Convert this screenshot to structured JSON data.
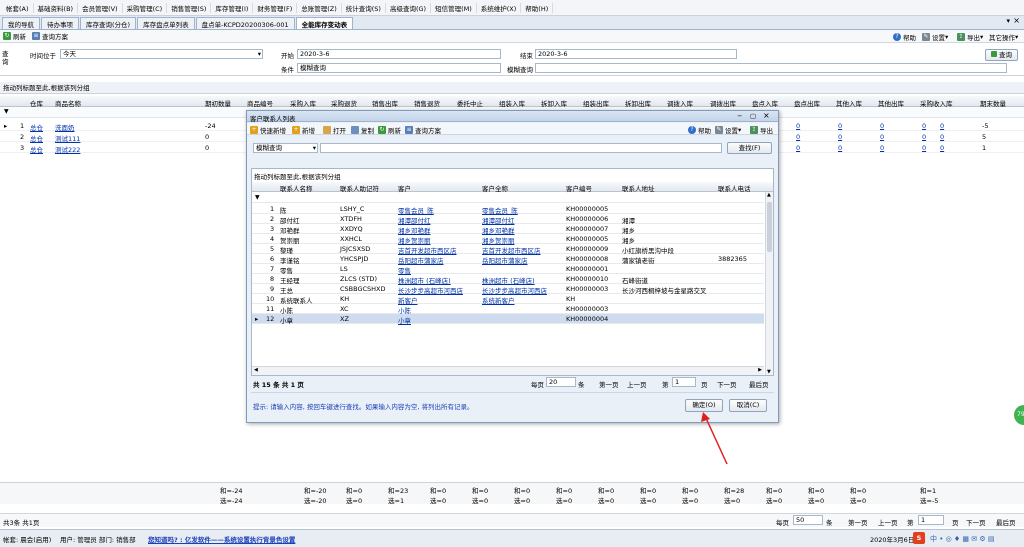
{
  "menu": [
    "帐套(A)",
    "基础资料(B)",
    "会员管理(V)",
    "采购管理(C)",
    "销售管理(S)",
    "库存管理(I)",
    "财务管理(F)",
    "总账管理(Z)",
    "统计查询(S)",
    "高级查询(G)",
    "短信管理(M)",
    "系统维护(X)",
    "帮助(H)"
  ],
  "tabs": [
    "我的导航",
    "待办事项",
    "库存查询(分仓)",
    "库存盘点单列表",
    "盘点单-KCPD20200306-001",
    "全能库存变动表"
  ],
  "toolbar": {
    "refresh": "刷新",
    "query_plan": "查询方案",
    "help": "帮助",
    "settings": "设置",
    "export": "导出",
    "other_ops": "其它操作"
  },
  "query": {
    "side_label": "查询",
    "time_label": "时间位于",
    "time_value": "今天",
    "start_label": "开始",
    "start_value": "2020-3-6",
    "end_label": "结束",
    "end_value": "2020-3-6",
    "cond_label": "条件",
    "cond_value": "模糊查询",
    "fuzzy_label": "模糊查询",
    "query_button": "查询"
  },
  "group_hint": "拖动列标题至此,根据该列分组",
  "main_table": {
    "headers": [
      "仓库",
      "商品名称",
      "期初数量",
      "商品编号",
      "采购入库",
      "采购退货",
      "销售出库",
      "销售退货",
      "委托中止",
      "组装入库",
      "拆卸入库",
      "组装出库",
      "拆卸出库",
      "调拨入库",
      "调拨出库",
      "盘点入库",
      "盘点出库",
      "其他入库",
      "其他出库",
      "采购收入库",
      "期末数量"
    ],
    "rows": [
      {
        "no": "1",
        "warehouse": "总仓",
        "product": "洗面奶",
        "opening": "-24",
        "c1": "0",
        "c2": "0",
        "c3": "0",
        "c4": "0",
        "c5": "0",
        "ending": "-5"
      },
      {
        "no": "2",
        "warehouse": "总仓",
        "product": "测试111",
        "opening": "0",
        "c1": "0",
        "c2": "0",
        "c3": "0",
        "c4": "0",
        "c5": "0",
        "ending": "5"
      },
      {
        "no": "3",
        "warehouse": "总仓",
        "product": "测试222",
        "opening": "0",
        "c1": "0",
        "c2": "0",
        "c3": "0",
        "c4": "0",
        "c5": "0",
        "ending": "1"
      }
    ]
  },
  "summary": {
    "row1": [
      "和=-24",
      "和=-20",
      "和=0",
      "和=23",
      "和=0",
      "和=0",
      "和=0",
      "和=0",
      "和=0",
      "和=0",
      "和=0",
      "和=28",
      "和=0",
      "和=0",
      "和=0",
      "和=1"
    ],
    "row2": [
      "选=-24",
      "选=-20",
      "选=0",
      "选=1",
      "选=0",
      "选=0",
      "选=0",
      "选=0",
      "选=0",
      "选=0",
      "选=0",
      "选=0",
      "选=0",
      "选=0",
      "选=0",
      "选=-5"
    ]
  },
  "pager": {
    "total": "共3条 共1页",
    "per_page_label": "每页",
    "per_page": "50",
    "per_unit": "条",
    "first": "第一页",
    "prev": "上一页",
    "page_label": "第",
    "page": "1",
    "page_unit": "页",
    "next": "下一页",
    "last": "最后页"
  },
  "status": {
    "company": "帐套: 晨会(启用)",
    "user": "用户: 管理员 部门: 销售部",
    "marquee": "您知道吗? : 亿发软件——系统设置执行背景色设置",
    "date": "2020年3月6日"
  },
  "dialog": {
    "title": "客户联系人列表",
    "toolbar": {
      "quick_add": "快速新增",
      "add": "新增",
      "open": "打开",
      "copy": "复制",
      "refresh": "刷新",
      "query_plan": "查询方案",
      "help": "帮助",
      "settings": "设置",
      "export": "导出"
    },
    "search_mode": "模糊查询",
    "search_button": "查找(F)",
    "group_hint": "拖动列标题至此,根据该列分组",
    "headers": [
      "联系人名称",
      "联系人助记符",
      "客户",
      "客户全称",
      "客户编号",
      "联系人地址",
      "联系人电话"
    ],
    "rows": [
      {
        "no": "1",
        "name": "陈",
        "code": "LSHY_C",
        "cust": "零售会员_陈",
        "full": "零售会员_陈",
        "id": "KH00000005",
        "addr": "",
        "phone": ""
      },
      {
        "no": "2",
        "name": "邵付红",
        "code": "XTDFH",
        "cust": "湘潭邵付红",
        "full": "湘潭邵付红",
        "id": "KH00000006",
        "addr": "湘潭",
        "phone": ""
      },
      {
        "no": "3",
        "name": "邓艳群",
        "code": "XXDYQ",
        "cust": "湘乡邓艳群",
        "full": "湘乡邓艳群",
        "id": "KH00000007",
        "addr": "湘乡",
        "phone": ""
      },
      {
        "no": "4",
        "name": "贺崇丽",
        "code": "XXHCL",
        "cust": "湘乡贺崇丽",
        "full": "湘乡贺崇丽",
        "id": "KH00000005",
        "addr": "湘乡",
        "phone": ""
      },
      {
        "no": "5",
        "name": "黎瑾",
        "code": "JSJCSXSD",
        "cust": "吉首开发超市西区店",
        "full": "吉首开发超市西区店",
        "id": "KH00000009",
        "addr": "小红旗桥黑沟中段",
        "phone": ""
      },
      {
        "no": "6",
        "name": "李谨铭",
        "code": "YHCSPJD",
        "cust": "岳阳超市蒲家店",
        "full": "岳阳超市蒲家店",
        "id": "KH00000008",
        "addr": "蒲家镇老街",
        "phone": "3882365"
      },
      {
        "no": "7",
        "name": "零售",
        "code": "LS",
        "cust": "零售",
        "full": "",
        "id": "KH00000001",
        "addr": "",
        "phone": ""
      },
      {
        "no": "8",
        "name": "王经理",
        "code": "ZLCS (STD)",
        "cust": "株洲超市 (石峰店)",
        "full": "株洲超市 (石峰店)",
        "id": "KH00000010",
        "addr": "石峰街道",
        "phone": ""
      },
      {
        "no": "9",
        "name": "王总",
        "code": "CSBBGCSHXD",
        "cust": "长沙步步高超市河西店",
        "full": "长沙步步高超市河西店",
        "id": "KH00000003",
        "addr": "长沙河西桐梓坡与金星路交叉",
        "phone": ""
      },
      {
        "no": "10",
        "name": "系统联系人",
        "code": "KH",
        "cust": "新客户",
        "full": "系统新客户",
        "id": "KH",
        "addr": "",
        "phone": ""
      },
      {
        "no": "11",
        "name": "小陈",
        "code": "XC",
        "cust": "小陈",
        "full": "",
        "id": "KH00000003",
        "addr": "",
        "phone": ""
      },
      {
        "no": "12",
        "name": "小章",
        "code": "XZ",
        "cust": "小章",
        "full": "",
        "id": "KH00000004",
        "addr": "",
        "phone": ""
      }
    ],
    "pager": {
      "total": "共 15 条  共 1 页",
      "per_page_label": "每页",
      "per_page": "20",
      "per_unit": "条",
      "first": "第一页",
      "prev": "上一页",
      "page_label": "第",
      "page": "1",
      "page_unit": "页",
      "next": "下一页",
      "last": "最后页"
    },
    "tip": "提示: 请输入内容, 按回车键进行查找。如果输入内容为空, 将列出所有记录。",
    "ok": "确定(O)",
    "cancel": "取消(C)"
  },
  "colors": {
    "accent": "#0033aa",
    "selected_row": "#cfdcef",
    "annotation_arrow": "#e02020"
  }
}
